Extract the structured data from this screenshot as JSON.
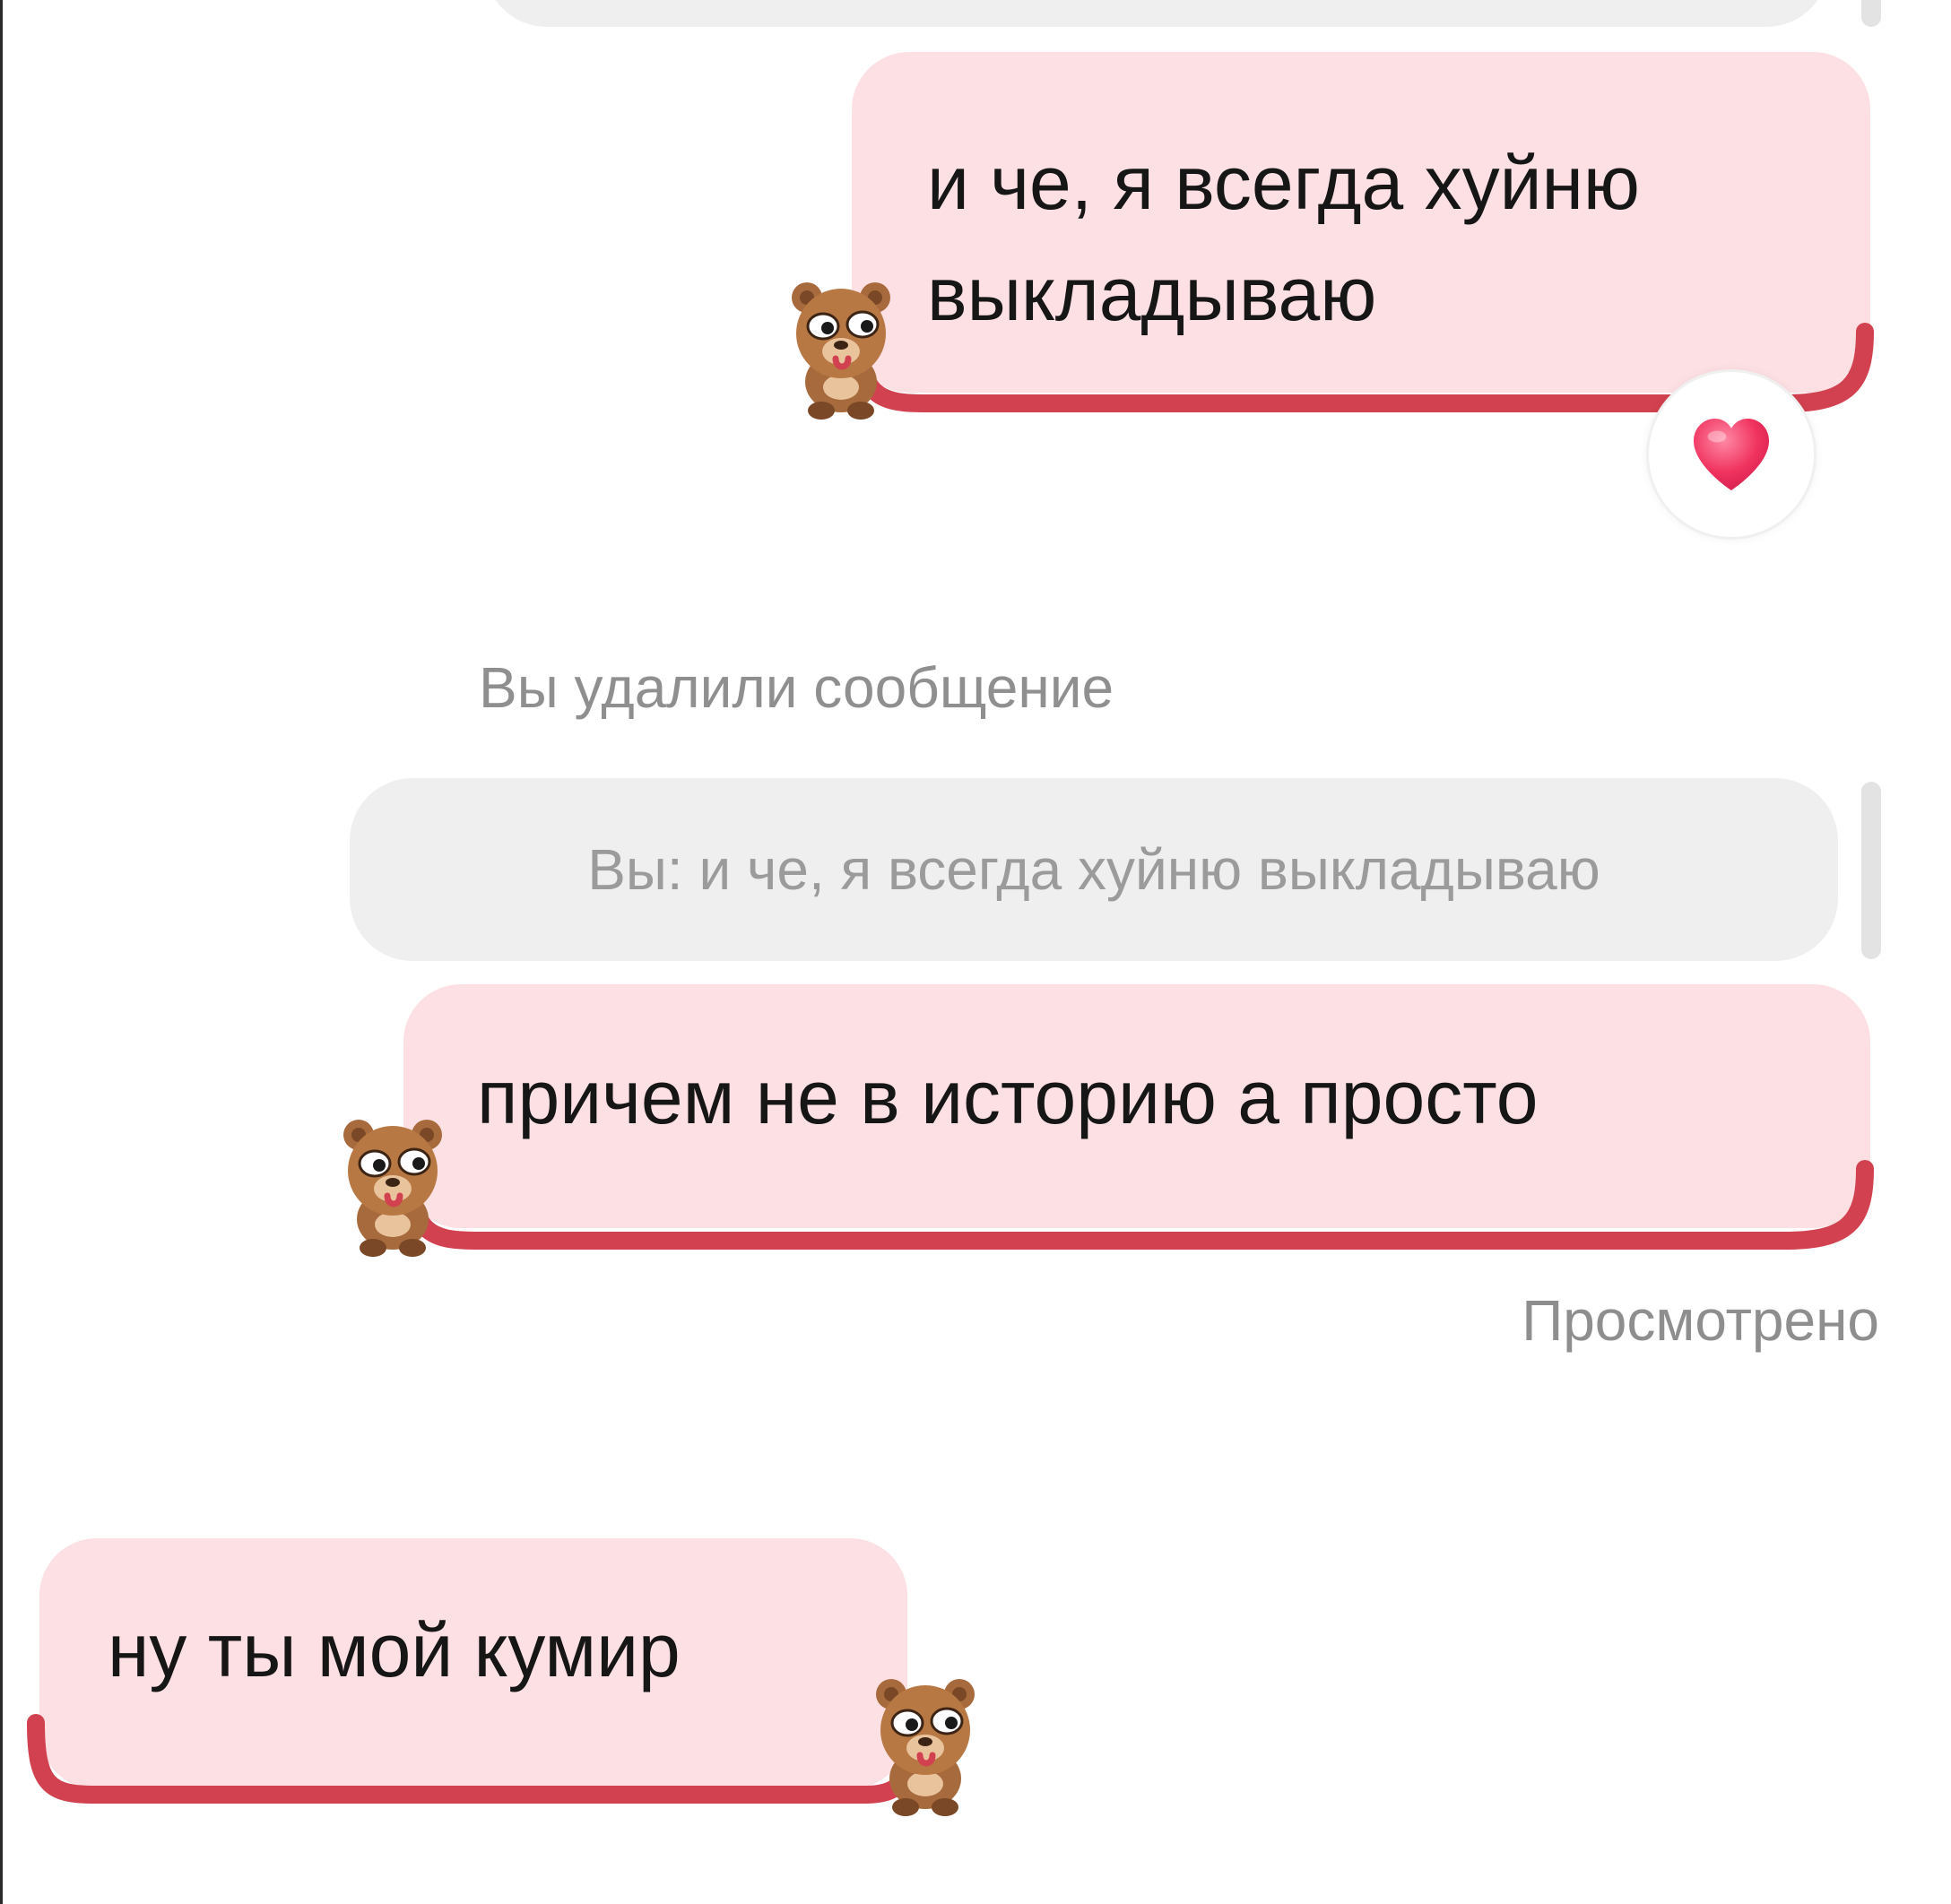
{
  "conversation": {
    "messages": [
      {
        "text_line1": "и че, я всегда хуйню",
        "text_line2": "выкладываю",
        "sender": "me",
        "reaction": "heart"
      },
      {
        "text": "причем не в историю а просто",
        "sender": "me",
        "reply_preview": "Вы: и че, я всегда хуйню выкладываю"
      },
      {
        "text": "ну ты мой кумир",
        "sender": "them"
      }
    ],
    "deleted_notice": "Вы удалили сообщение",
    "seen_status": "Просмотрено"
  },
  "icons": {
    "reaction": "heart-icon",
    "sticker": "bear-sticker-icon"
  },
  "colors": {
    "bubble_background": "#fde0e3",
    "bubble_underline": "#d2414f",
    "reply_background": "#efefef",
    "muted_text": "#8f8f8f",
    "heart": "#f0335f"
  }
}
